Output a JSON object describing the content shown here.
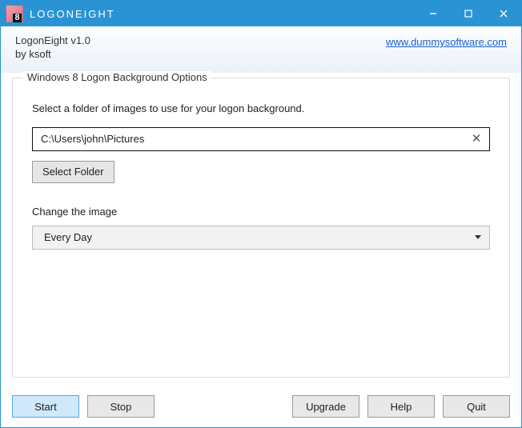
{
  "titlebar": {
    "title": "LOGONEIGHT"
  },
  "header": {
    "app_name_version": "LogonEight v1.0",
    "vendor": "by ksoft",
    "link_text": "www.dummysoftware.com"
  },
  "group": {
    "legend": "Windows 8 Logon Background Options",
    "instruction": "Select a folder of images to use for your logon background.",
    "folder_path": "C:\\Users\\john\\Pictures",
    "select_folder_label": "Select Folder",
    "change_label": "Change the image",
    "interval_selected": "Every Day"
  },
  "footer": {
    "start": "Start",
    "stop": "Stop",
    "upgrade": "Upgrade",
    "help": "Help",
    "quit": "Quit"
  }
}
